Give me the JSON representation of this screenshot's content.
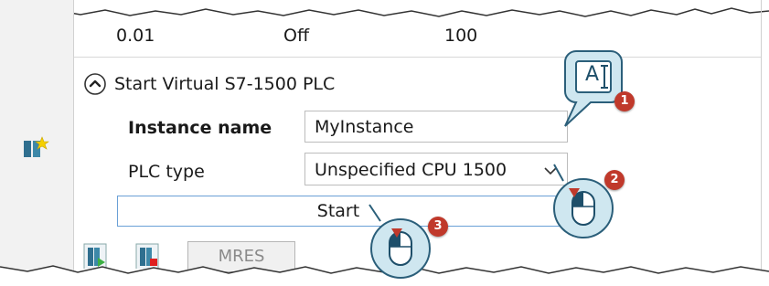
{
  "top_row": {
    "value1": "0.01",
    "value2": "Off",
    "value3": "100"
  },
  "section": {
    "title": "Start Virtual S7-1500 PLC"
  },
  "form": {
    "instance_name_label": "Instance name",
    "instance_name_value": "MyInstance",
    "plc_type_label": "PLC type",
    "plc_type_value": "Unspecified CPU 1500"
  },
  "buttons": {
    "start_label": "Start",
    "mres_label": "MRES"
  },
  "callouts": {
    "step1": "1",
    "step2": "2",
    "step3": "3",
    "text_cursor_glyph": "A"
  },
  "colors": {
    "badge": "#c0392b",
    "callout_bubble": "#cde6ef",
    "start_border": "#6aa0d6"
  }
}
